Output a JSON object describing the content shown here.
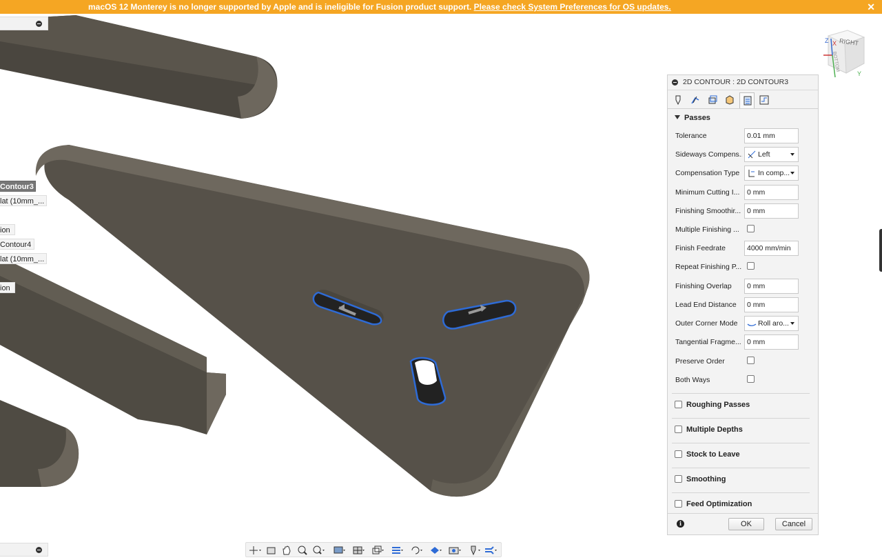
{
  "banner": {
    "message": "macOS 12 Monterey is no longer supported by Apple and is ineligible for Fusion product support.",
    "link": "Please check System Preferences for OS updates.",
    "close": "✕"
  },
  "browser_tree": {
    "items": [
      {
        "label": "Contour3",
        "selected": true
      },
      {
        "label": "lat (10mm_..."
      },
      {
        "label": "ion"
      },
      {
        "label": "Contour4"
      },
      {
        "label": "lat (10mm_..."
      },
      {
        "label": "ion"
      }
    ]
  },
  "viewcube": {
    "face_right": "RIGHT",
    "face_bottom": "BOTTOM",
    "axis_x": "X",
    "axis_y": "Y",
    "axis_z": "Z"
  },
  "panel": {
    "title": "2D CONTOUR : 2D CONTOUR3",
    "section": "Passes",
    "rows": [
      {
        "label": "Tolerance",
        "value": "0.01 mm"
      },
      {
        "label": "Sideways Compens...",
        "value": "Left"
      },
      {
        "label": "Compensation Type",
        "value": "In comp..."
      },
      {
        "label": "Minimum Cutting I...",
        "value": "0 mm"
      },
      {
        "label": "Finishing Smoothir...",
        "value": "0 mm"
      },
      {
        "label": "Multiple Finishing ...",
        "checked": false
      },
      {
        "label": "Finish Feedrate",
        "value": "4000 mm/min"
      },
      {
        "label": "Repeat Finishing P...",
        "checked": false
      },
      {
        "label": "Finishing Overlap",
        "value": "0 mm"
      },
      {
        "label": "Lead End Distance",
        "value": "0 mm"
      },
      {
        "label": "Outer Corner Mode",
        "value": "Roll aro..."
      },
      {
        "label": "Tangential Fragme...",
        "value": "0 mm"
      },
      {
        "label": "Preserve Order",
        "checked": false
      },
      {
        "label": "Both Ways",
        "checked": false
      }
    ],
    "groups": [
      "Roughing Passes",
      "Multiple Depths",
      "Stock to Leave",
      "Smoothing",
      "Feed Optimization"
    ],
    "ok": "OK",
    "cancel": "Cancel",
    "info": "i"
  },
  "colors": {
    "banner": "#f5a623",
    "part": "#565149",
    "part_top": "#6e685e",
    "toolpath": "#2e6bd6"
  }
}
